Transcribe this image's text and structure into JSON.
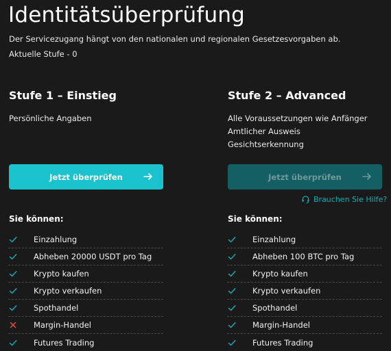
{
  "header": {
    "title": "Identitätsüberprüfung",
    "subtitle": "Der Servicezugang hängt von den nationalen und regionalen Gesetzesvorgaben ab.",
    "current_level": "Aktuelle Stufe - 0"
  },
  "colors": {
    "background": "#1a1a1a",
    "accent": "#19c2cd",
    "accent_disabled": "#135f63",
    "check": "#19a8b0",
    "cross": "#e5484d"
  },
  "levels": [
    {
      "title": "Stufe 1 – Einstieg",
      "requirements": [
        "Persönliche Angaben"
      ],
      "button_label": "Jetzt überprüfen",
      "button_icon": "arrow-right-icon",
      "can_heading": "Sie können:",
      "permissions": [
        {
          "label": "Einzahlung",
          "allowed": true
        },
        {
          "label": "Abheben 20000 USDT pro Tag",
          "allowed": true
        },
        {
          "label": "Krypto kaufen",
          "allowed": true
        },
        {
          "label": "Krypto verkaufen",
          "allowed": true
        },
        {
          "label": "Spothandel",
          "allowed": true
        },
        {
          "label": "Margin-Handel",
          "allowed": false
        },
        {
          "label": "Futures Trading",
          "allowed": true
        }
      ]
    },
    {
      "title": "Stufe 2 – Advanced",
      "requirements": [
        "Alle Voraussetzungen wie Anfänger",
        "Amtlicher Ausweis",
        "Gesichtserkennung"
      ],
      "button_label": "Jetzt überprüfen",
      "button_icon": "arrow-right-icon",
      "help_label": "Brauchen Sie Hilfe?",
      "help_icon": "headset-icon",
      "can_heading": "Sie können:",
      "permissions": [
        {
          "label": "Einzahlung",
          "allowed": true
        },
        {
          "label": "Abheben 100 BTC pro Tag",
          "allowed": true
        },
        {
          "label": "Krypto kaufen",
          "allowed": true
        },
        {
          "label": "Krypto verkaufen",
          "allowed": true
        },
        {
          "label": "Spothandel",
          "allowed": true
        },
        {
          "label": "Margin-Handel",
          "allowed": true
        },
        {
          "label": "Futures Trading",
          "allowed": true
        }
      ]
    }
  ]
}
